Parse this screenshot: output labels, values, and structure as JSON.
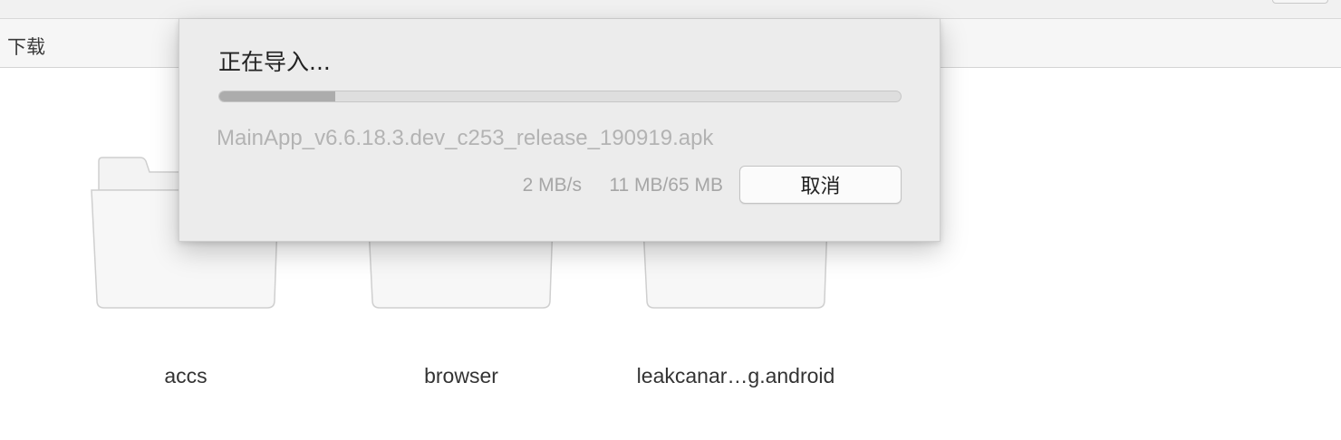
{
  "pathbar": {
    "location": "下载"
  },
  "folders": [
    {
      "name": "accs",
      "icon": "folder-icon"
    },
    {
      "name": "browser",
      "icon": "folder-icon"
    },
    {
      "name": "leakcanar…g.android",
      "icon": "folder-icon"
    }
  ],
  "dialog": {
    "title": "正在导入...",
    "progress_fraction": 0.17,
    "file_name": "MainApp_v6.6.18.3.dev_c253_release_190919.apk",
    "speed": "2 MB/s",
    "size": "11 MB/65 MB",
    "cancel_label": "取消"
  },
  "colors": {
    "dialog_bg": "#ececec",
    "progress_fill": "#acacac",
    "progress_track": "#dedede",
    "folder_fill": "#f7f7f7",
    "folder_stroke": "#cfcfcf"
  }
}
